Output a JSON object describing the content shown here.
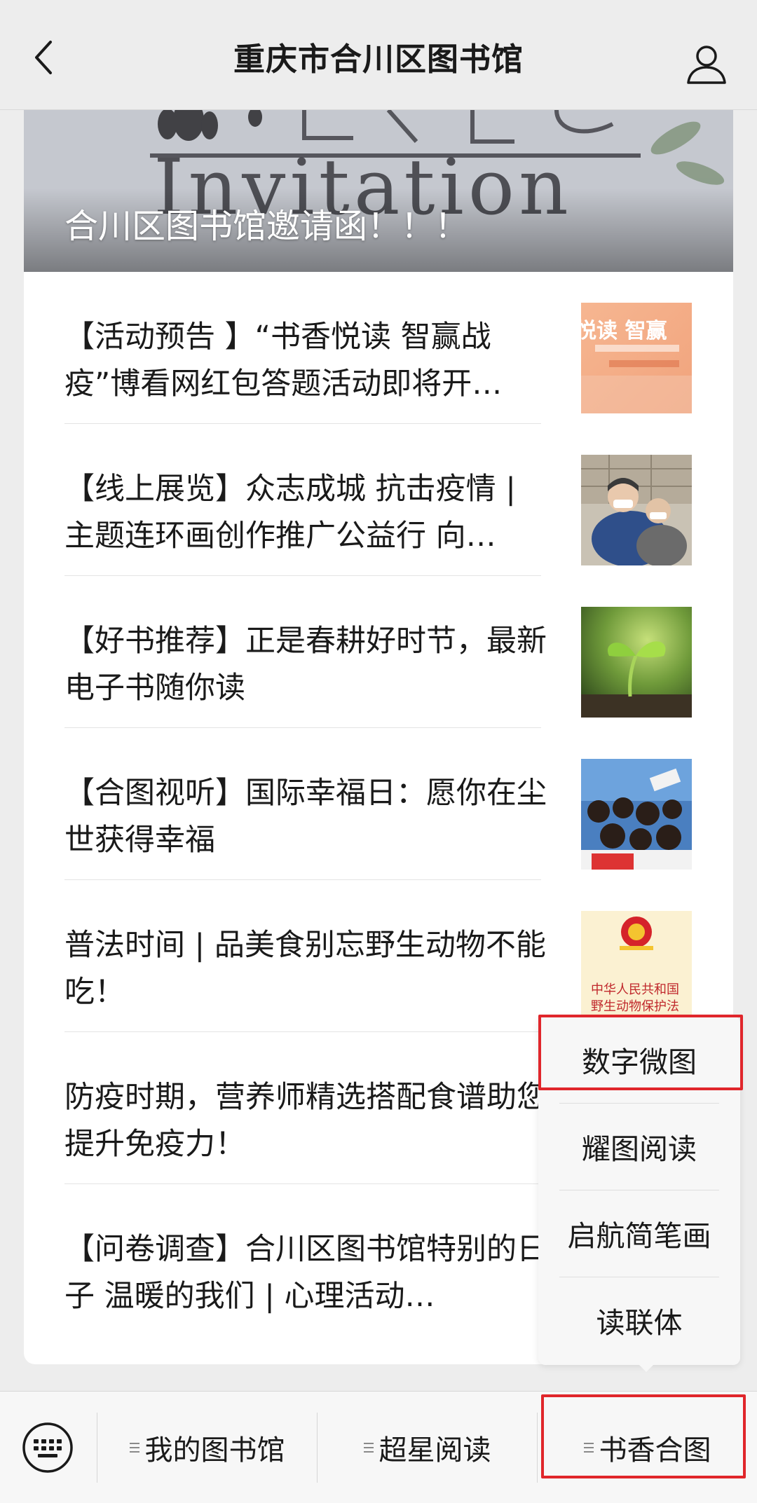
{
  "header": {
    "title": "重庆市合川区图书馆",
    "back_icon": "chevron-left-icon",
    "profile_icon": "user-profile-icon"
  },
  "banner": {
    "title": "合川区图书馆邀请函！！！",
    "art_text": "Invitation"
  },
  "articles": [
    {
      "title": "【活动预告 】“书香悦读 智赢战疫”博看网红包答题活动即将开启",
      "display": "【活动预告 】“书香悦读 智赢战疫”博看网红包答题活动即将开…",
      "thumb_text": "悦读 智赢"
    },
    {
      "title": "【线上展览】众志成城 抗击疫情 | 主题连环画创作推广公益行 向…",
      "display": "【线上展览】众志成城 抗击疫情 | 主题连环画创作推广公益行 向…"
    },
    {
      "title": "【好书推荐】正是春耕好时节，最新电子书随你读",
      "display": "【好书推荐】正是春耕好时节，最新电子书随你读"
    },
    {
      "title": "【合图视听】国际幸福日：愿你在尘世获得幸福",
      "display": "【合图视听】国际幸福日：愿你在尘世获得幸福"
    },
    {
      "title": "普法时间 | 品美食别忘野生动物不能吃！",
      "display": "普法时间 | 品美食别忘野生动物不能吃！",
      "thumb_text_1": "中华人民共和国",
      "thumb_text_2": "野生动物保护法"
    },
    {
      "title": "防疫时期，营养师精选搭配食谱助您提升免疫力！",
      "display": "防疫时期，营养师精选搭配食谱助您提升免疫力！"
    },
    {
      "title": "【问卷调查】合川区图书馆特别的日子 温暖的我们 | 心理活动…",
      "display": "【问卷调查】合川区图书馆特别的日子 温暖的我们 | 心理活动…"
    }
  ],
  "submenu": {
    "items": [
      "数字微图",
      "耀图阅读",
      "启航简笔画",
      "读联体"
    ],
    "highlighted_index": 0
  },
  "bottom_menu": {
    "keyboard_icon": "keyboard-icon",
    "items": [
      "我的图书馆",
      "超星阅读",
      "书香合图"
    ],
    "highlighted_index": 2
  },
  "colors": {
    "background": "#ededed",
    "card": "#ffffff",
    "highlight": "#e0262b",
    "divider": "#e4e4e4"
  }
}
